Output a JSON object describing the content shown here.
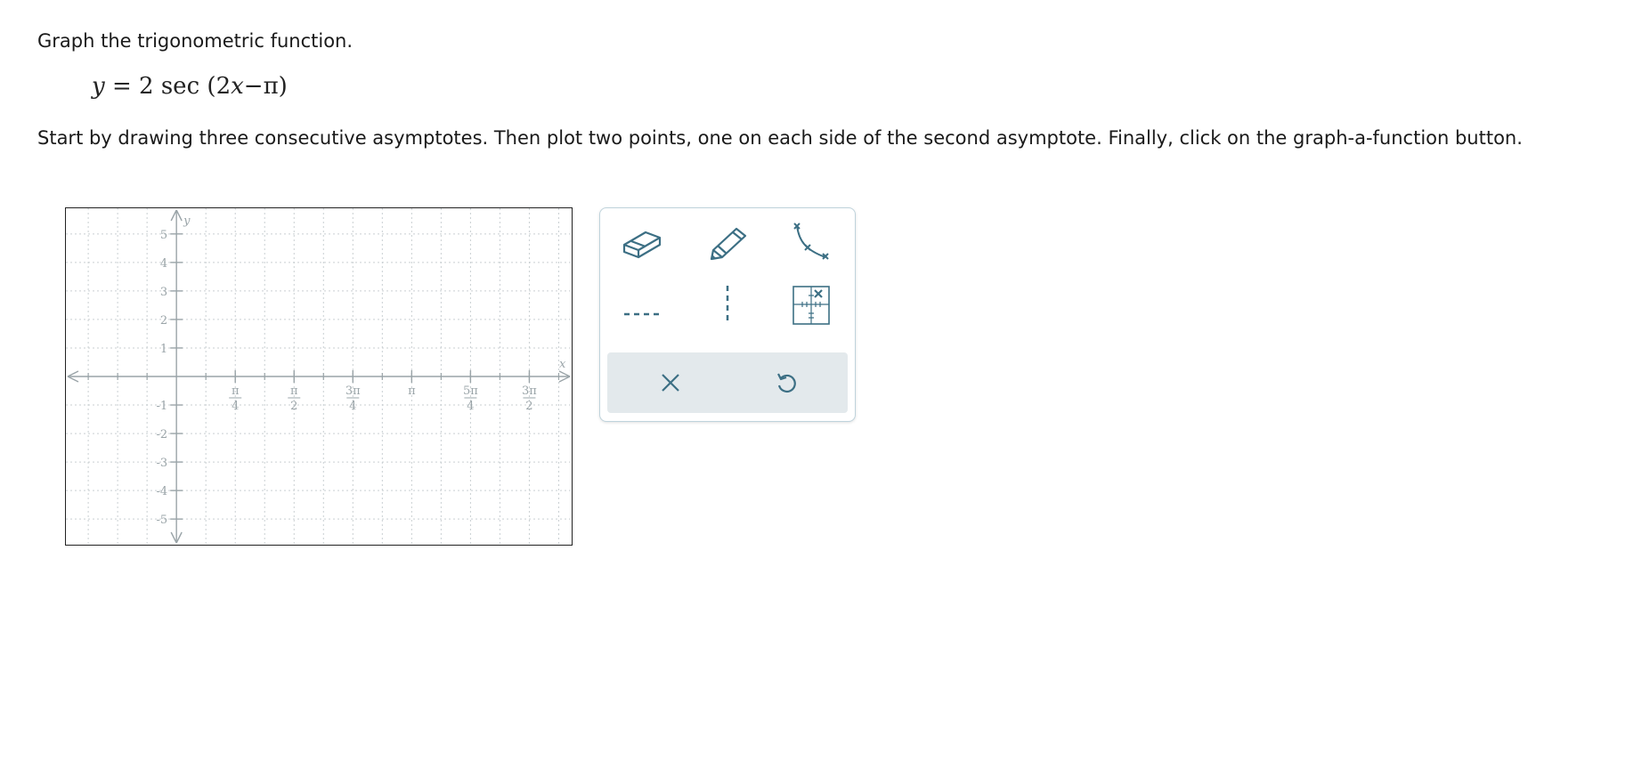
{
  "question": {
    "prompt": "Graph the trigonometric function.",
    "equation": {
      "lhs": "y",
      "equals": "=",
      "coef": "2",
      "func": "sec",
      "open": "(",
      "arg_coef": "2",
      "arg_var": "x",
      "minus": "−",
      "pi": "π",
      "close": ")"
    },
    "instructions": "Start by drawing three consecutive asymptotes. Then plot two points, one on each side of the second asymptote. Finally, click on the graph-a-function button."
  },
  "graph": {
    "x_axis_label": "x",
    "y_axis_label": "y",
    "x_range": [
      -0.47,
      1.68
    ],
    "y_range": [
      -5.9,
      5.9
    ],
    "x_ticks": [
      {
        "value": 0.25,
        "num": "π",
        "den": "4"
      },
      {
        "value": 0.5,
        "num": "π",
        "den": "2"
      },
      {
        "value": 0.75,
        "num": "3π",
        "den": "4"
      },
      {
        "value": 1.0,
        "num": "π",
        "den": ""
      },
      {
        "value": 1.25,
        "num": "5π",
        "den": "4"
      },
      {
        "value": 1.5,
        "num": "3π",
        "den": "2"
      }
    ],
    "x_ticks_unit": "multiples of π",
    "y_ticks": [
      {
        "value": 5,
        "label": "5"
      },
      {
        "value": 4,
        "label": "4"
      },
      {
        "value": 3,
        "label": "3"
      },
      {
        "value": 2,
        "label": "2"
      },
      {
        "value": 1,
        "label": "1"
      },
      {
        "value": -1,
        "label": "-1"
      },
      {
        "value": -2,
        "label": "-2"
      },
      {
        "value": -3,
        "label": "-3"
      },
      {
        "value": -4,
        "label": "-4"
      },
      {
        "value": -5,
        "label": "-5"
      }
    ],
    "grid": true,
    "grid_color": "#c9cfd2"
  },
  "toolbar": {
    "accent": "#3c6f84",
    "tools": [
      "eraser-icon",
      "pencil-icon",
      "graph-function-icon",
      "horizontal-asymptote-icon",
      "vertical-asymptote-icon",
      "point-tool-icon"
    ],
    "actions": [
      "clear-icon",
      "undo-icon"
    ]
  }
}
